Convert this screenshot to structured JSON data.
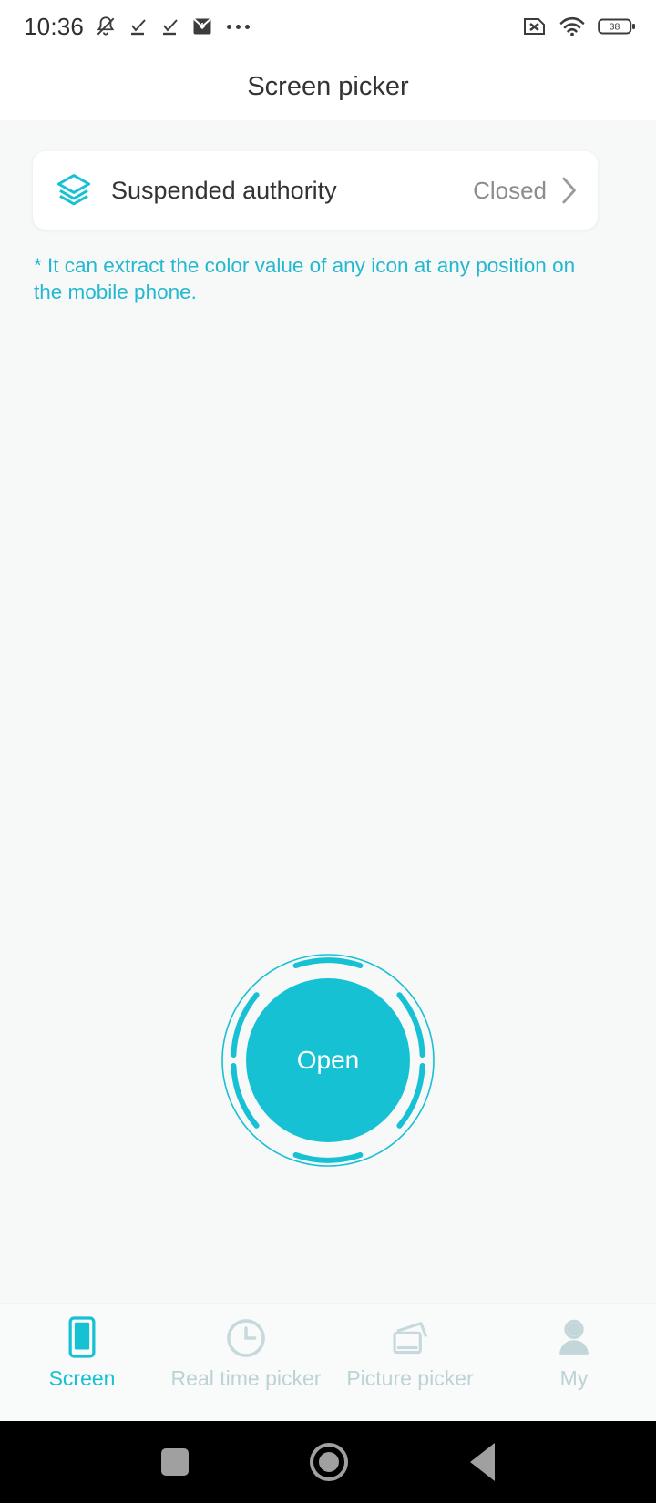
{
  "colors": {
    "accent": "#17c1d4",
    "hint_text": "#24b8cf",
    "tab_inactive": "#bdd2d5",
    "card_bg": "#ffffff",
    "page_bg": "#f7f8f8",
    "status_text": "#8c8c8c"
  },
  "status_bar": {
    "time": "10:36",
    "left_icons": [
      "bell-mute-icon",
      "checkmark-icon",
      "checkmark-icon",
      "mail-download-icon",
      "more-dots-icon"
    ],
    "right_icons": [
      "sim-card-x-icon",
      "wifi-icon",
      "battery-icon"
    ],
    "battery_level": "38"
  },
  "header": {
    "title": "Screen picker"
  },
  "permission_card": {
    "icon": "layers-icon",
    "label": "Suspended authority",
    "status": "Closed",
    "chevron": "chevron-right-icon"
  },
  "hint": {
    "text": "* It can extract the color value of any icon at any position on the mobile phone."
  },
  "main_action": {
    "label": "Open"
  },
  "tabbar": {
    "items": [
      {
        "label": "Screen",
        "icon": "phone-screen-icon",
        "active": true
      },
      {
        "label": "Real time picker",
        "icon": "clock-icon",
        "active": false
      },
      {
        "label": "Picture picker",
        "icon": "pictures-icon",
        "active": false
      },
      {
        "label": "My",
        "icon": "person-icon",
        "active": false
      }
    ]
  },
  "system_nav": {
    "recents": "square-icon",
    "home": "circle-icon",
    "back": "triangle-left-icon"
  }
}
